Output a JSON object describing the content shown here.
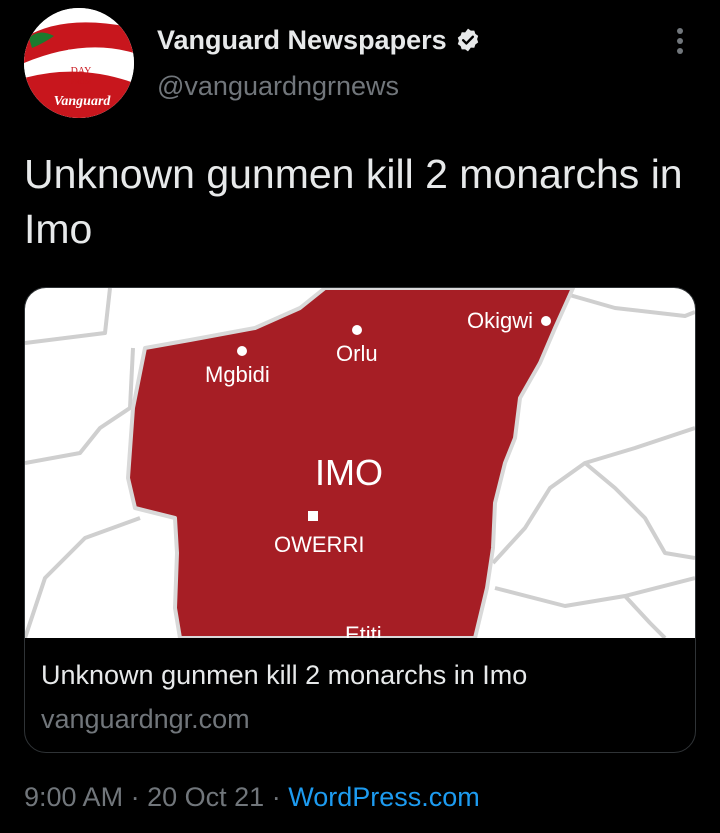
{
  "account": {
    "name": "Vanguard Newspapers",
    "handle": "@vanguardngrnews",
    "avatar_text": {
      "line1": "HAPPY",
      "line2": "INDEPENDENCE",
      "line3": "DAY",
      "line4": "FROM",
      "line5": "Vanguard"
    }
  },
  "tweet": {
    "text": "Unknown gunmen kill 2 monarchs in Imo"
  },
  "card": {
    "map_labels": {
      "okigwi": "Okigwi",
      "orlu": "Orlu",
      "mgbidi": "Mgbidi",
      "state": "IMO",
      "owerri": "OWERRI",
      "etiti": "Etiti"
    },
    "title": "Unknown gunmen kill 2 monarchs in Imo",
    "domain": "vanguardngr.com"
  },
  "meta": {
    "time": "9:00 AM",
    "separator": "·",
    "date": "20 Oct 21",
    "source": "WordPress.com"
  },
  "icons": {
    "verified": "verified-badge-icon",
    "more": "more-options-icon"
  },
  "colors": {
    "background": "#000000",
    "text": "#e7e9ea",
    "muted": "#71767b",
    "link": "#1d9bf0",
    "map_red": "#a61e25",
    "brand_red": "#c8161d"
  }
}
